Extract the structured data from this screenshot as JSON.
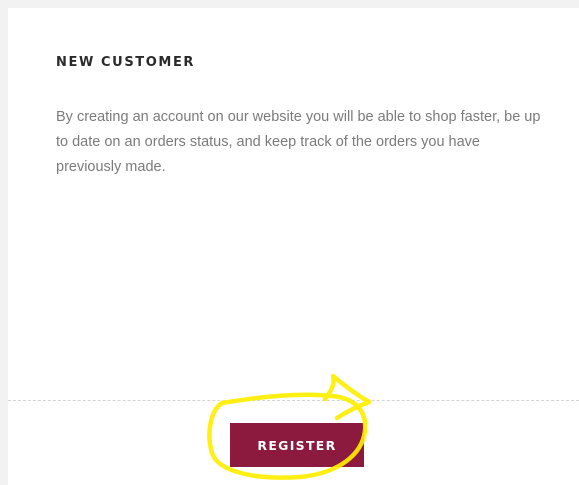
{
  "section": {
    "heading": "NEW CUSTOMER",
    "description": "By creating an account on our website you will be able to shop faster, be up to date on an orders status, and keep track of the orders you have previously made."
  },
  "actions": {
    "register_label": "REGISTER"
  },
  "colors": {
    "button_background": "#8b1a3e",
    "highlight_annotation": "#ffee00"
  }
}
